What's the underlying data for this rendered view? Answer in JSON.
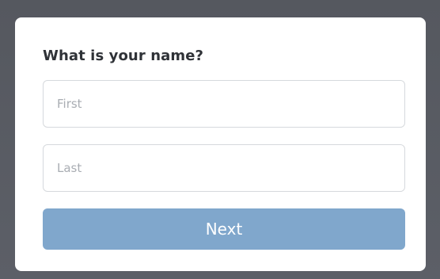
{
  "form": {
    "question": "What is your name?",
    "first_placeholder": "First",
    "first_value": "",
    "last_placeholder": "Last",
    "last_value": "",
    "next_label": "Next"
  },
  "colors": {
    "backdrop": "#595c64",
    "card": "#ffffff",
    "button": "#80a7cc",
    "button_text": "#ffffff",
    "field_border": "#d6d9dd",
    "placeholder": "#a9adb3",
    "heading": "#2f3237"
  }
}
